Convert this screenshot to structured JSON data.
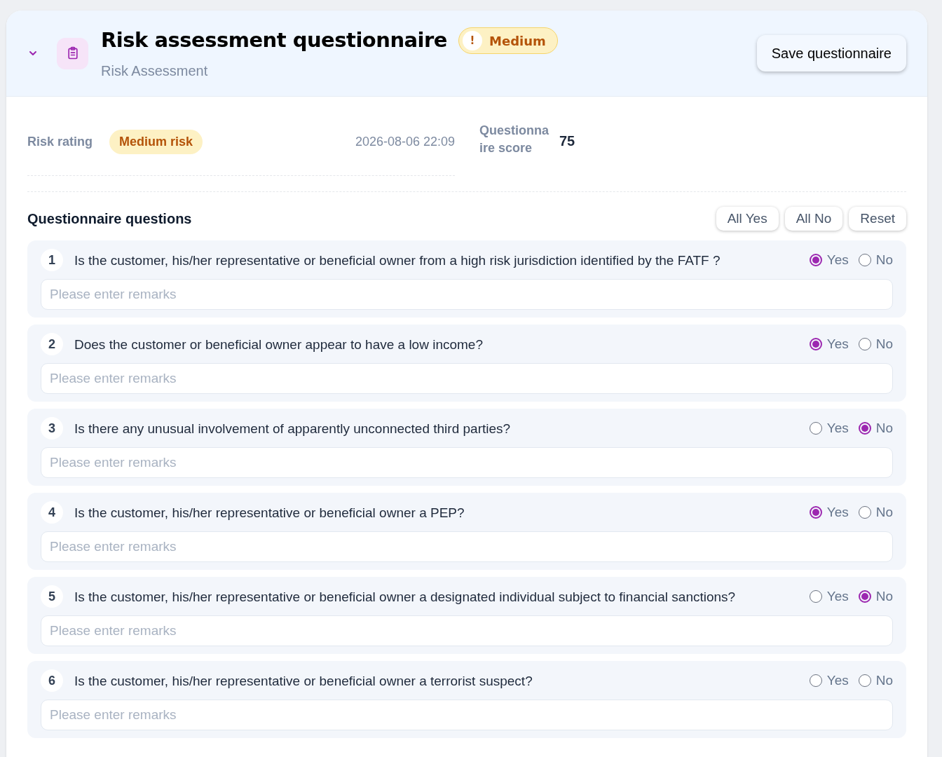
{
  "header": {
    "title": "Risk assessment questionnaire",
    "badge": "Medium",
    "badge_icon": "!",
    "subtitle": "Risk Assessment",
    "expanded": true,
    "save_button": "Save questionnaire"
  },
  "summary": {
    "rating_label": "Risk rating",
    "rating": "Medium risk",
    "timestamp": "2026-08-06 22:09",
    "score_label": "Questionna ire score",
    "score": "75"
  },
  "questions_section": {
    "title": "Questionnaire questions",
    "actions": [
      "All Yes",
      "All No",
      "Reset"
    ],
    "questions": [
      {
        "number": "1",
        "text": "Is the customer, his/her representative or beneficial owner from a high risk jurisdiction identified by the FATF ?",
        "options": [
          {
            "label": "Yes",
            "selected": true
          },
          {
            "label": "No",
            "selected": false
          }
        ],
        "remarks_placeholder": "Please enter remarks"
      },
      {
        "number": "2",
        "text": "Does the customer or beneficial owner appear to have a low income?",
        "options": [
          {
            "label": "Yes",
            "selected": true
          },
          {
            "label": "No",
            "selected": false
          }
        ],
        "remarks_placeholder": "Please enter remarks"
      },
      {
        "number": "3",
        "text": "Is there any unusual involvement of apparently unconnected third parties?",
        "options": [
          {
            "label": "Yes",
            "selected": false
          },
          {
            "label": "No",
            "selected": true
          }
        ],
        "remarks_placeholder": "Please enter remarks"
      },
      {
        "number": "4",
        "text": "Is the customer, his/her representative or beneficial owner a PEP?",
        "options": [
          {
            "label": "Yes",
            "selected": true
          },
          {
            "label": "No",
            "selected": false
          }
        ],
        "remarks_placeholder": "Please enter remarks"
      },
      {
        "number": "5",
        "text": "Is the customer, his/her representative or beneficial owner a designated individual subject to financial sanctions?",
        "options": [
          {
            "label": "Yes",
            "selected": false
          },
          {
            "label": "No",
            "selected": true
          }
        ],
        "remarks_placeholder": "Please enter remarks"
      },
      {
        "number": "6",
        "text": "Is the customer, his/her representative or beneficial owner a terrorist suspect?",
        "options": [
          {
            "label": "Yes",
            "selected": false
          },
          {
            "label": "No",
            "selected": false
          }
        ],
        "remarks_placeholder": "Please enter remarks"
      }
    ]
  }
}
